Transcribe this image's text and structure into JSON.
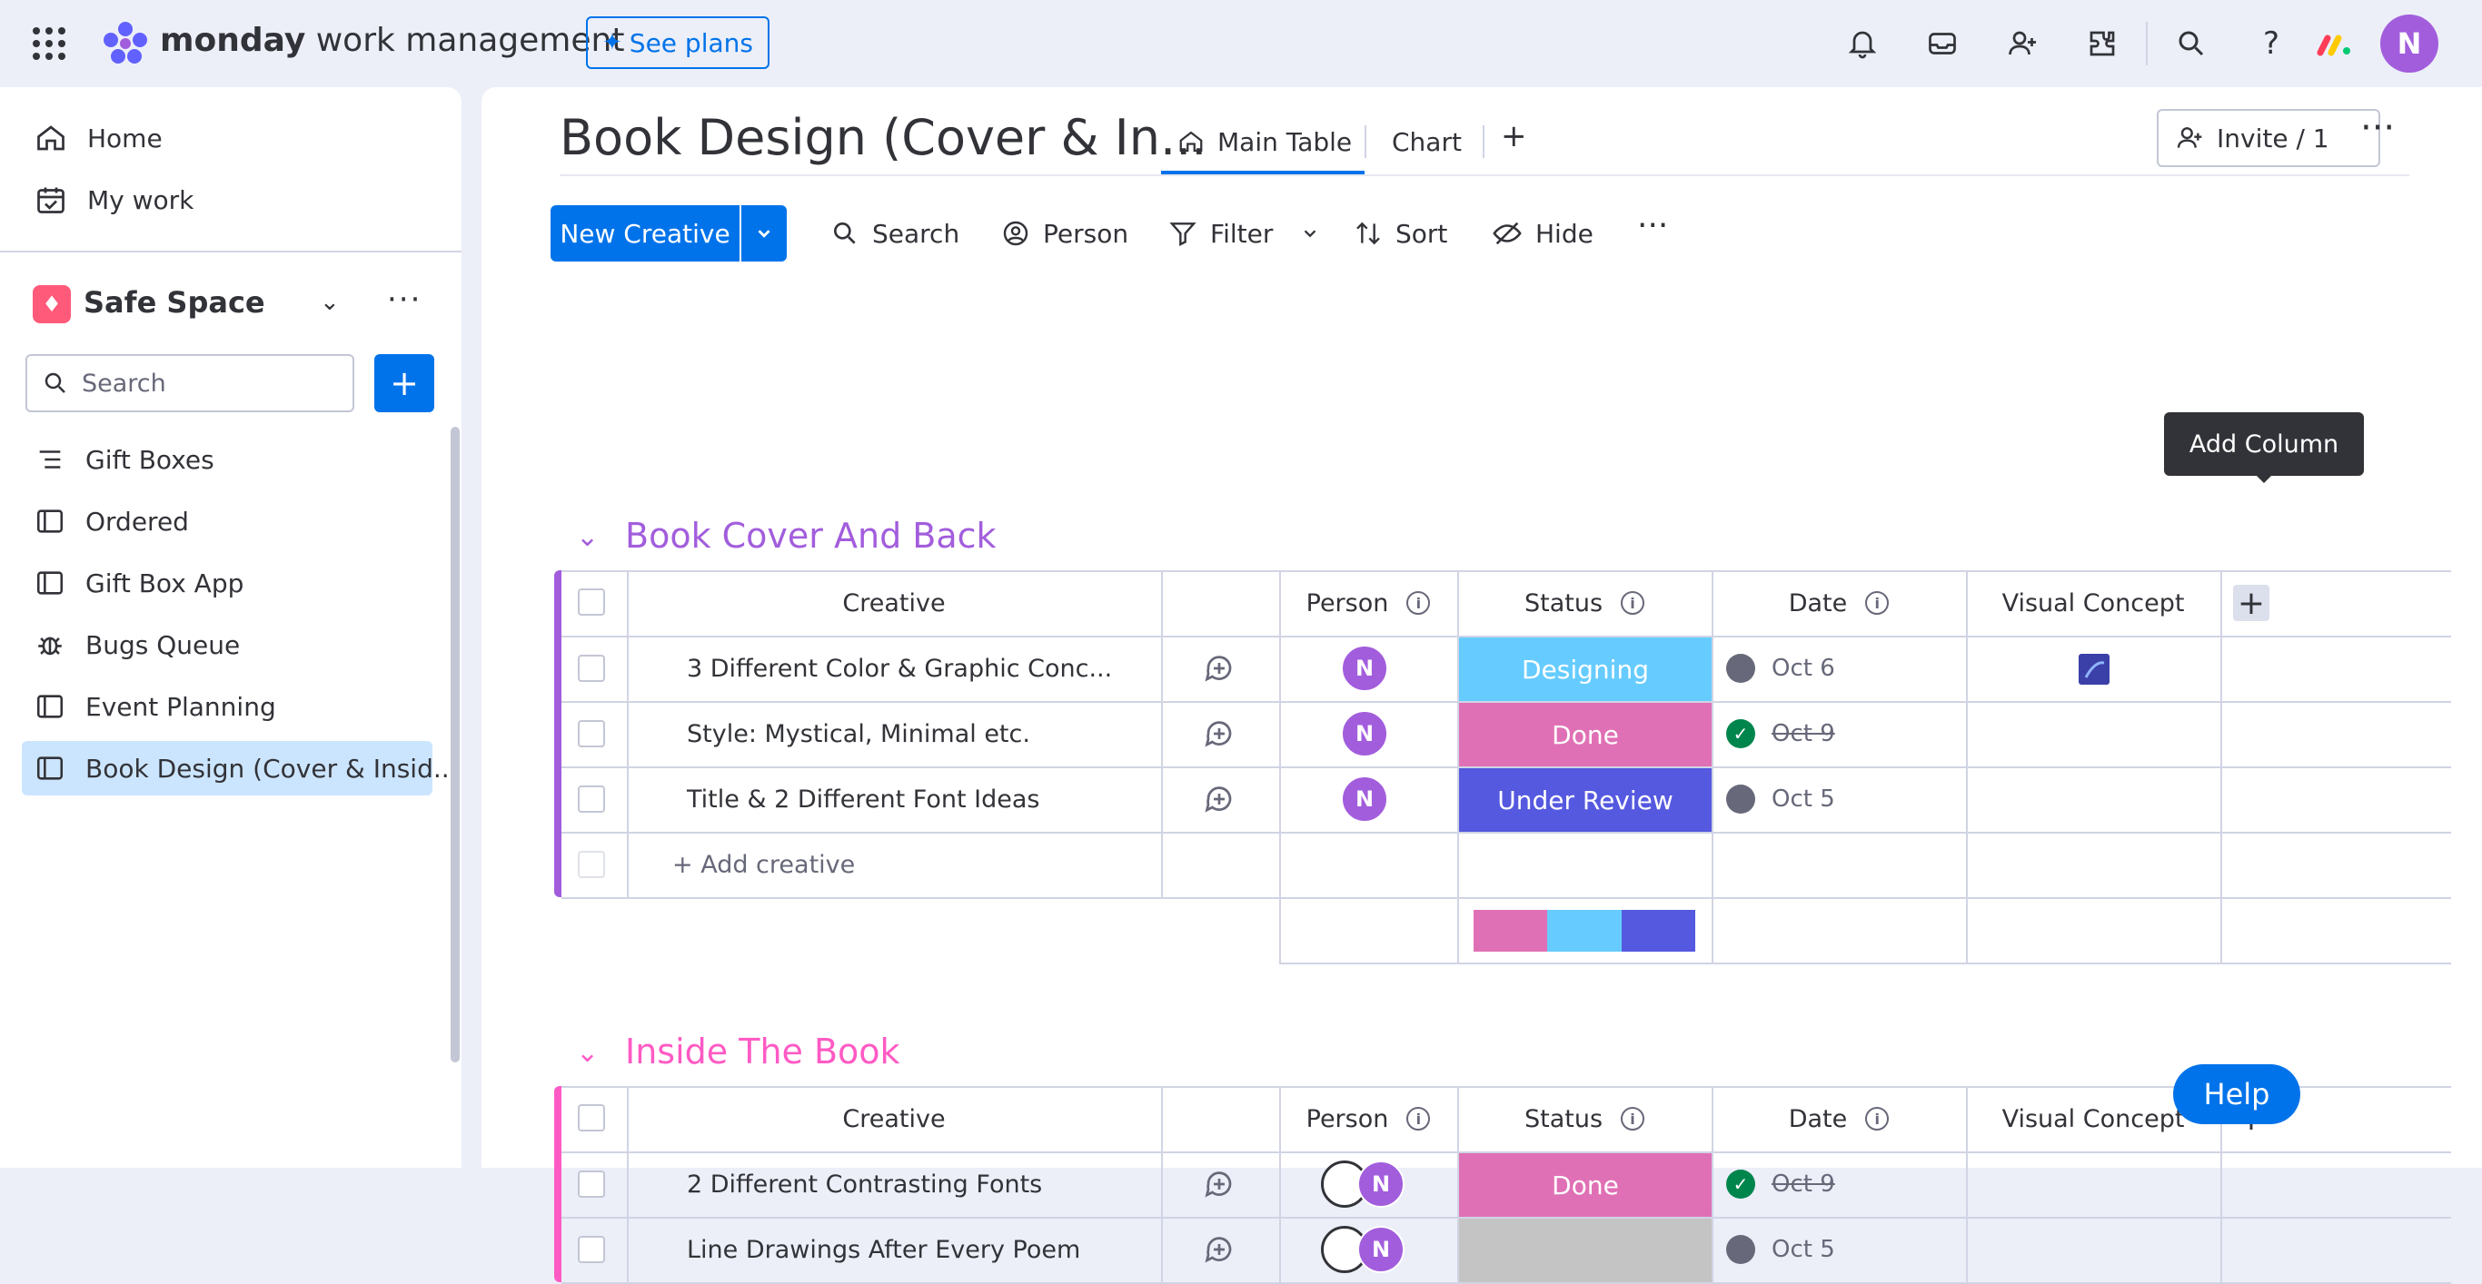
{
  "app": {
    "brand_bold": "monday",
    "brand_rest": " work management",
    "see_plans": "See plans",
    "user_initial": "N"
  },
  "sidebar": {
    "home": "Home",
    "my_work": "My work",
    "workspace": "Safe Space",
    "search_placeholder": "Search",
    "items": [
      {
        "label": "Gift Boxes",
        "icon": "list-icon"
      },
      {
        "label": "Ordered",
        "icon": "board-icon"
      },
      {
        "label": "Gift Box App",
        "icon": "board-icon"
      },
      {
        "label": "Bugs Queue",
        "icon": "bug-icon"
      },
      {
        "label": "Event Planning",
        "icon": "board-icon"
      },
      {
        "label": "Book Design (Cover & Insid...",
        "icon": "board-icon"
      }
    ]
  },
  "board": {
    "title": "Book Design (Cover & In...",
    "tabs": [
      "Main Table",
      "Chart"
    ],
    "invite": "Invite / 1",
    "new_item": "New Creative",
    "toolbar": {
      "search": "Search",
      "person": "Person",
      "filter": "Filter",
      "sort": "Sort",
      "hide": "Hide"
    },
    "tooltip": "Add Column",
    "help": "Help",
    "columns": {
      "creative": "Creative",
      "person": "Person",
      "status": "Status",
      "date": "Date",
      "visual": "Visual Concept"
    },
    "groups": [
      {
        "title": "Book Cover And Back",
        "color": "#a25ddc",
        "add_item": "+ Add creative",
        "rows": [
          {
            "name": "3 Different Color & Graphic Conc...",
            "person": "N",
            "status": "Designing",
            "status_color": "#66ccff",
            "date": "Oct 6",
            "done": false
          },
          {
            "name": "Style: Mystical, Minimal etc.",
            "person": "N",
            "status": "Done",
            "status_color": "#e070b5",
            "date": "Oct 9",
            "done": true
          },
          {
            "name": "Title & 2 Different Font Ideas",
            "person": "N",
            "status": "Under Review",
            "status_color": "#5559df",
            "date": "Oct 5",
            "done": false
          }
        ]
      },
      {
        "title": "Inside The Book",
        "color": "#ff5ac4",
        "rows": [
          {
            "name": "2 Different Contrasting Fonts",
            "person": "N",
            "status": "Done",
            "status_color": "#e070b5",
            "date": "Oct 9",
            "done": true
          },
          {
            "name": "Line Drawings After Every Poem",
            "person": "N",
            "status": "",
            "status_color": "#c4c4c4",
            "date": "Oct 5",
            "done": false
          }
        ]
      }
    ]
  }
}
